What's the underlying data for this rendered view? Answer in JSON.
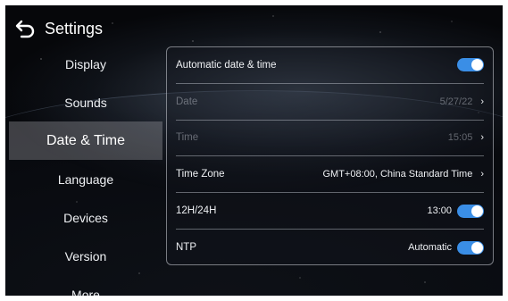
{
  "header": {
    "title": "Settings",
    "back_icon": "back-arrow-icon"
  },
  "sidebar": {
    "items": [
      {
        "label": "Display",
        "active": false
      },
      {
        "label": "Sounds",
        "active": false
      },
      {
        "label": "Date & Time",
        "active": true
      },
      {
        "label": "Language",
        "active": false
      },
      {
        "label": "Devices",
        "active": false
      },
      {
        "label": "Version",
        "active": false
      },
      {
        "label": "More",
        "active": false
      }
    ]
  },
  "panel": {
    "auto_date_time": {
      "label": "Automatic date & time",
      "enabled": true
    },
    "date": {
      "label": "Date",
      "value": "5/27/22"
    },
    "time": {
      "label": "Time",
      "value": "15:05"
    },
    "time_zone": {
      "label": "Time Zone",
      "value": "GMT+08:00, China Standard Time"
    },
    "format": {
      "label": "12H/24H",
      "value": "13:00",
      "enabled": true
    },
    "ntp": {
      "label": "NTP",
      "value": "Automatic",
      "enabled": true
    }
  },
  "colors": {
    "accent": "#3a8ee6",
    "active_bg": "#8f9096"
  }
}
